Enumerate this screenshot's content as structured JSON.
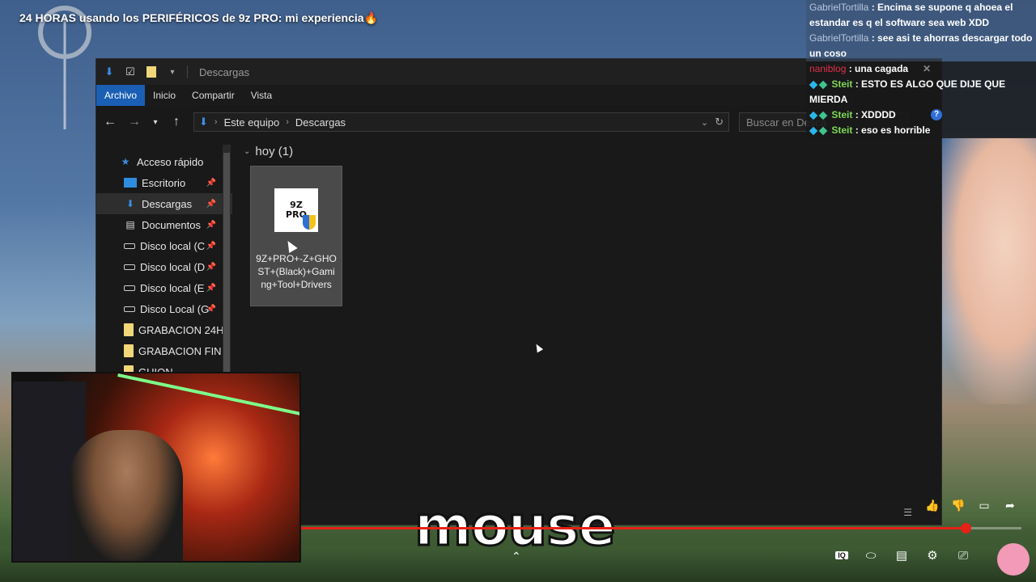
{
  "video": {
    "title": "24 HORAS usando los PERIFÉRICOS de 9z PRO: mi experiencia🔥",
    "caption": "mouse",
    "progress_fraction": 0.923
  },
  "explorer": {
    "window_title": "Descargas",
    "ribbon_tabs": [
      "Archivo",
      "Inicio",
      "Compartir",
      "Vista"
    ],
    "breadcrumb": [
      "Este equipo",
      "Descargas"
    ],
    "search_placeholder": "Buscar en Descargas",
    "nav_items": [
      {
        "label": "Acceso rápido",
        "icon": "star-icon"
      },
      {
        "label": "Escritorio",
        "icon": "desktop-folder-icon"
      },
      {
        "label": "Descargas",
        "icon": "download-icon"
      },
      {
        "label": "Documentos",
        "icon": "document-icon"
      },
      {
        "label": "Disco local (C",
        "icon": "drive-icon"
      },
      {
        "label": "Disco local (D",
        "icon": "drive-icon"
      },
      {
        "label": "Disco local (E",
        "icon": "drive-icon"
      },
      {
        "label": "Disco Local (G",
        "icon": "drive-icon"
      },
      {
        "label": "GRABACION 24H",
        "icon": "folder-icon"
      },
      {
        "label": "GRABACION FIN",
        "icon": "folder-icon"
      },
      {
        "label": "GUION",
        "icon": "folder-icon"
      }
    ],
    "group_header": "hoy (1)",
    "file": {
      "name": "9Z+PRO+-Z+GHOST+(Black)+Gaming+Tool+Drivers",
      "logo_text": "9Z PRO"
    }
  },
  "chat": [
    {
      "user": "GabrielTortilla",
      "text": "Encima se supone q ahoea el estandar es q el software sea web XDD",
      "style": "bg"
    },
    {
      "user": "GabrielTortilla",
      "text": "see asi te ahorras descargar todo un coso",
      "style": "bg"
    },
    {
      "user": "naniblog",
      "text": "una cagada",
      "style": "dark"
    },
    {
      "user": "Steit",
      "text": "ESTO ES ALGO QUE DIJE QUE MIERDA",
      "style": "dark"
    },
    {
      "user": "Steit",
      "text": "XDDDD",
      "style": "dark"
    },
    {
      "user": "Steit",
      "text": "eso es horrible",
      "style": "dark"
    }
  ],
  "controls": [
    "IQ",
    "toggle",
    "CC",
    "settings",
    "cast"
  ],
  "colors": {
    "accent": "#1a5fb4",
    "progress": "#e62117"
  }
}
